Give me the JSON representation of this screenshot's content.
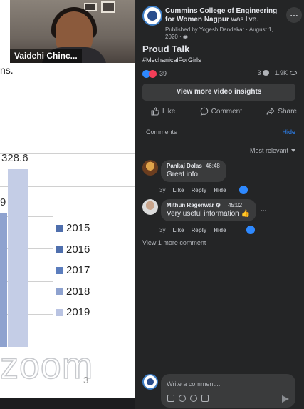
{
  "video": {
    "participant_name": "Vaidehi Chinc...",
    "slide_top_text": "ns.",
    "bar_value_label": "328.6",
    "bar_partial_label": "9",
    "legend": [
      "2015",
      "2016",
      "2017",
      "2018",
      "2019"
    ],
    "legend_colors": [
      "#4f6fad",
      "#4f6fad",
      "#5b7dbd",
      "#8ea2cf",
      "#b9c3e2"
    ],
    "watermark": "zoom",
    "page_number": "3"
  },
  "post": {
    "page_name": "Cummins College of Engineering for Women Nagpur",
    "was_live": " was live.",
    "published": "Published by Yogesh Dandekar · August 1, 2020 ·",
    "more": "…",
    "title": "Proud Talk",
    "hashtag": "#MechanicalForGirls",
    "reaction_count": "39",
    "comments_count": "3",
    "views": "1.9K",
    "insights_button": "View more video insights",
    "actions": {
      "like": "Like",
      "comment": "Comment",
      "share": "Share"
    }
  },
  "comments_section": {
    "tab": "Comments",
    "hide": "Hide",
    "sort": "Most relevant",
    "items": [
      {
        "author": "Pankaj Dolas",
        "time": "46:48",
        "text": "Great info",
        "age": "3y",
        "like": "Like",
        "reply": "Reply",
        "hide": "Hide"
      },
      {
        "author": "Mithun Ragenwar",
        "time": "45:02",
        "text": "Very useful information 👍",
        "age": "3y",
        "like": "Like",
        "reply": "Reply",
        "hide": "Hide",
        "more": "..."
      }
    ],
    "view_more": "View 1 more comment"
  },
  "composer": {
    "placeholder": "Write a comment..."
  }
}
